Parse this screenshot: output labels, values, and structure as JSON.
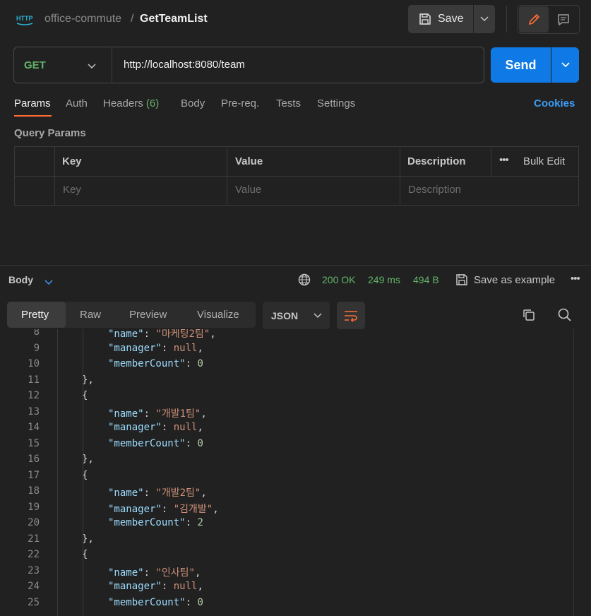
{
  "header": {
    "collection": "office-commute",
    "separator": "/",
    "request_name": "GetTeamList",
    "save_label": "Save"
  },
  "request": {
    "method": "GET",
    "url": "http://localhost:8080/team",
    "send_label": "Send"
  },
  "tabs": {
    "params": "Params",
    "auth": "Auth",
    "headers": "Headers",
    "headers_count": "(6)",
    "body": "Body",
    "prereq": "Pre-req.",
    "tests": "Tests",
    "settings": "Settings",
    "cookies": "Cookies"
  },
  "query_params": {
    "title": "Query Params",
    "columns": {
      "key": "Key",
      "value": "Value",
      "description": "Description"
    },
    "bulk_edit": "Bulk Edit",
    "placeholders": {
      "key": "Key",
      "value": "Value",
      "description": "Description"
    }
  },
  "response": {
    "body_label": "Body",
    "status": "200 OK",
    "time": "249 ms",
    "size": "494 B",
    "save_example": "Save as example",
    "views": [
      "Pretty",
      "Raw",
      "Preview",
      "Visualize"
    ],
    "format": "JSON"
  },
  "code_lines": [
    {
      "n": "8",
      "indent": 2,
      "tokens": [
        [
          "k",
          "\"name\""
        ],
        [
          "p",
          ": "
        ],
        [
          "s",
          "\"마케팅2팀\""
        ],
        [
          "p",
          ","
        ]
      ]
    },
    {
      "n": "9",
      "indent": 2,
      "tokens": [
        [
          "k",
          "\"manager\""
        ],
        [
          "p",
          ": "
        ],
        [
          "kw",
          "null"
        ],
        [
          "p",
          ","
        ]
      ]
    },
    {
      "n": "10",
      "indent": 2,
      "tokens": [
        [
          "k",
          "\"memberCount\""
        ],
        [
          "p",
          ": "
        ],
        [
          "n",
          "0"
        ]
      ]
    },
    {
      "n": "11",
      "indent": 1,
      "tokens": [
        [
          "p",
          "},"
        ]
      ]
    },
    {
      "n": "12",
      "indent": 1,
      "tokens": [
        [
          "p",
          "{"
        ]
      ]
    },
    {
      "n": "13",
      "indent": 2,
      "tokens": [
        [
          "k",
          "\"name\""
        ],
        [
          "p",
          ": "
        ],
        [
          "s",
          "\"개발1팀\""
        ],
        [
          "p",
          ","
        ]
      ]
    },
    {
      "n": "14",
      "indent": 2,
      "tokens": [
        [
          "k",
          "\"manager\""
        ],
        [
          "p",
          ": "
        ],
        [
          "kw",
          "null"
        ],
        [
          "p",
          ","
        ]
      ]
    },
    {
      "n": "15",
      "indent": 2,
      "tokens": [
        [
          "k",
          "\"memberCount\""
        ],
        [
          "p",
          ": "
        ],
        [
          "n",
          "0"
        ]
      ]
    },
    {
      "n": "16",
      "indent": 1,
      "tokens": [
        [
          "p",
          "},"
        ]
      ]
    },
    {
      "n": "17",
      "indent": 1,
      "tokens": [
        [
          "p",
          "{"
        ]
      ]
    },
    {
      "n": "18",
      "indent": 2,
      "tokens": [
        [
          "k",
          "\"name\""
        ],
        [
          "p",
          ": "
        ],
        [
          "s",
          "\"개발2팀\""
        ],
        [
          "p",
          ","
        ]
      ]
    },
    {
      "n": "19",
      "indent": 2,
      "tokens": [
        [
          "k",
          "\"manager\""
        ],
        [
          "p",
          ": "
        ],
        [
          "s",
          "\"김개발\""
        ],
        [
          "p",
          ","
        ]
      ]
    },
    {
      "n": "20",
      "indent": 2,
      "tokens": [
        [
          "k",
          "\"memberCount\""
        ],
        [
          "p",
          ": "
        ],
        [
          "n",
          "2"
        ]
      ]
    },
    {
      "n": "21",
      "indent": 1,
      "tokens": [
        [
          "p",
          "},"
        ]
      ]
    },
    {
      "n": "22",
      "indent": 1,
      "tokens": [
        [
          "p",
          "{"
        ]
      ]
    },
    {
      "n": "23",
      "indent": 2,
      "tokens": [
        [
          "k",
          "\"name\""
        ],
        [
          "p",
          ": "
        ],
        [
          "s",
          "\"인사팀\""
        ],
        [
          "p",
          ","
        ]
      ]
    },
    {
      "n": "24",
      "indent": 2,
      "tokens": [
        [
          "k",
          "\"manager\""
        ],
        [
          "p",
          ": "
        ],
        [
          "kw",
          "null"
        ],
        [
          "p",
          ","
        ]
      ]
    },
    {
      "n": "25",
      "indent": 2,
      "tokens": [
        [
          "k",
          "\"memberCount\""
        ],
        [
          "p",
          ": "
        ],
        [
          "n",
          "0"
        ]
      ]
    }
  ],
  "colors": {
    "accent_orange": "#ff6c37",
    "send_blue": "#0f7ae5",
    "success_green": "#63b36b",
    "link_blue": "#3d9cf5"
  }
}
